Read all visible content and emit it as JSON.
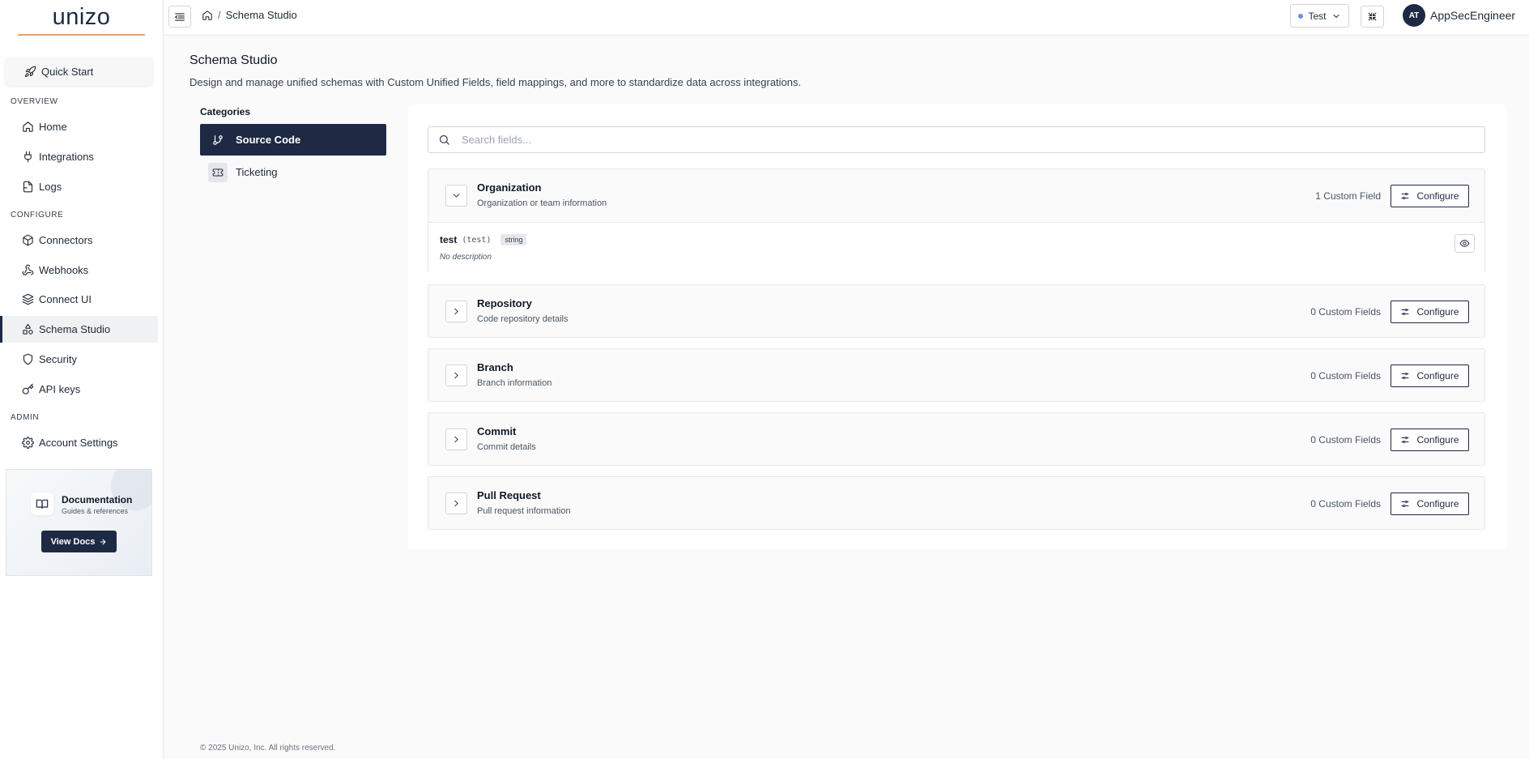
{
  "brand": {
    "logo_text": "unizo"
  },
  "sidebar": {
    "quick_start": "Quick Start",
    "sections": {
      "overview": "OVERVIEW",
      "configure": "CONFIGURE",
      "admin": "ADMIN"
    },
    "items": [
      {
        "label": "Home",
        "icon": "home-icon"
      },
      {
        "label": "Integrations",
        "icon": "plug-icon"
      },
      {
        "label": "Logs",
        "icon": "logs-icon"
      },
      {
        "label": "Connectors",
        "icon": "box-icon"
      },
      {
        "label": "Webhooks",
        "icon": "webhook-icon"
      },
      {
        "label": "Connect UI",
        "icon": "layers-icon"
      },
      {
        "label": "Schema Studio",
        "icon": "shapes-icon",
        "active": true
      },
      {
        "label": "Security",
        "icon": "shield-icon"
      },
      {
        "label": "API keys",
        "icon": "key-icon"
      },
      {
        "label": "Account Settings",
        "icon": "gear-icon"
      }
    ],
    "doc_card": {
      "title": "Documentation",
      "subtitle": "Guides & references",
      "button": "View Docs"
    }
  },
  "topbar": {
    "breadcrumb_current": "Schema Studio",
    "environment": "Test",
    "avatar_initials": "AT",
    "user_name": "AppSecEngineer"
  },
  "page": {
    "title": "Schema Studio",
    "description": "Design and manage unified schemas with Custom Unified Fields, field mappings, and more to standardize data across integrations."
  },
  "categories": {
    "label": "Categories",
    "items": [
      {
        "label": "Source Code",
        "icon": "git-branch-icon",
        "active": true
      },
      {
        "label": "Ticketing",
        "icon": "ticket-icon",
        "active": false
      }
    ]
  },
  "search": {
    "placeholder": "Search fields..."
  },
  "entities": [
    {
      "name": "Organization",
      "description": "Organization or team information",
      "count_label": "1 Custom Field",
      "expanded": true,
      "fields": [
        {
          "name": "test",
          "key": "(test)",
          "type": "string",
          "description": "No description"
        }
      ]
    },
    {
      "name": "Repository",
      "description": "Code repository details",
      "count_label": "0 Custom Fields",
      "expanded": false
    },
    {
      "name": "Branch",
      "description": "Branch information",
      "count_label": "0 Custom Fields",
      "expanded": false
    },
    {
      "name": "Commit",
      "description": "Commit details",
      "count_label": "0 Custom Fields",
      "expanded": false
    },
    {
      "name": "Pull Request",
      "description": "Pull request information",
      "count_label": "0 Custom Fields",
      "expanded": false
    }
  ],
  "configure_label": "Configure",
  "footer": "© 2025 Unizo, Inc. All rights reserved.",
  "colors": {
    "navy": "#1e2a44",
    "accent": "#e0a36a",
    "env_dot": "#6b8ed6"
  }
}
